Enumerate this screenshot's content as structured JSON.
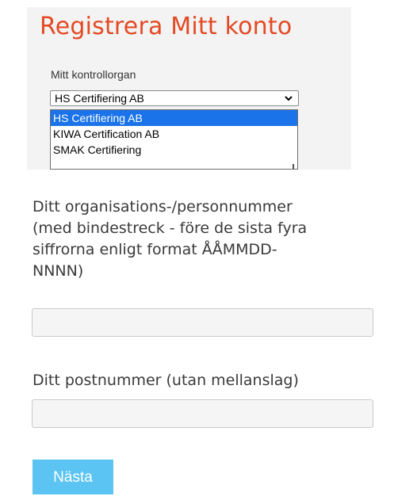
{
  "header": {
    "title": "Registrera Mitt konto"
  },
  "control_body": {
    "label": "Mitt kontrollorgan",
    "selected_value": "HS Certifiering AB",
    "options": [
      "HS Certifiering AB",
      "KIWA Certification AB",
      "SMAK Certifiering"
    ],
    "highlight_color": "#1a73e8"
  },
  "org_number": {
    "label_lines": [
      "Ditt organisations-/personnummer",
      "(med bindestreck - före de sista fyra",
      "siffrorna enligt format ÅÅMMDD-",
      "NNNN)"
    ],
    "value": ""
  },
  "postal_code": {
    "label": "Ditt postnummer (utan mellanslag)",
    "value": ""
  },
  "next_button": {
    "label": "Nästa",
    "color": "#5bc4f3"
  },
  "title_color": "#e34a24"
}
